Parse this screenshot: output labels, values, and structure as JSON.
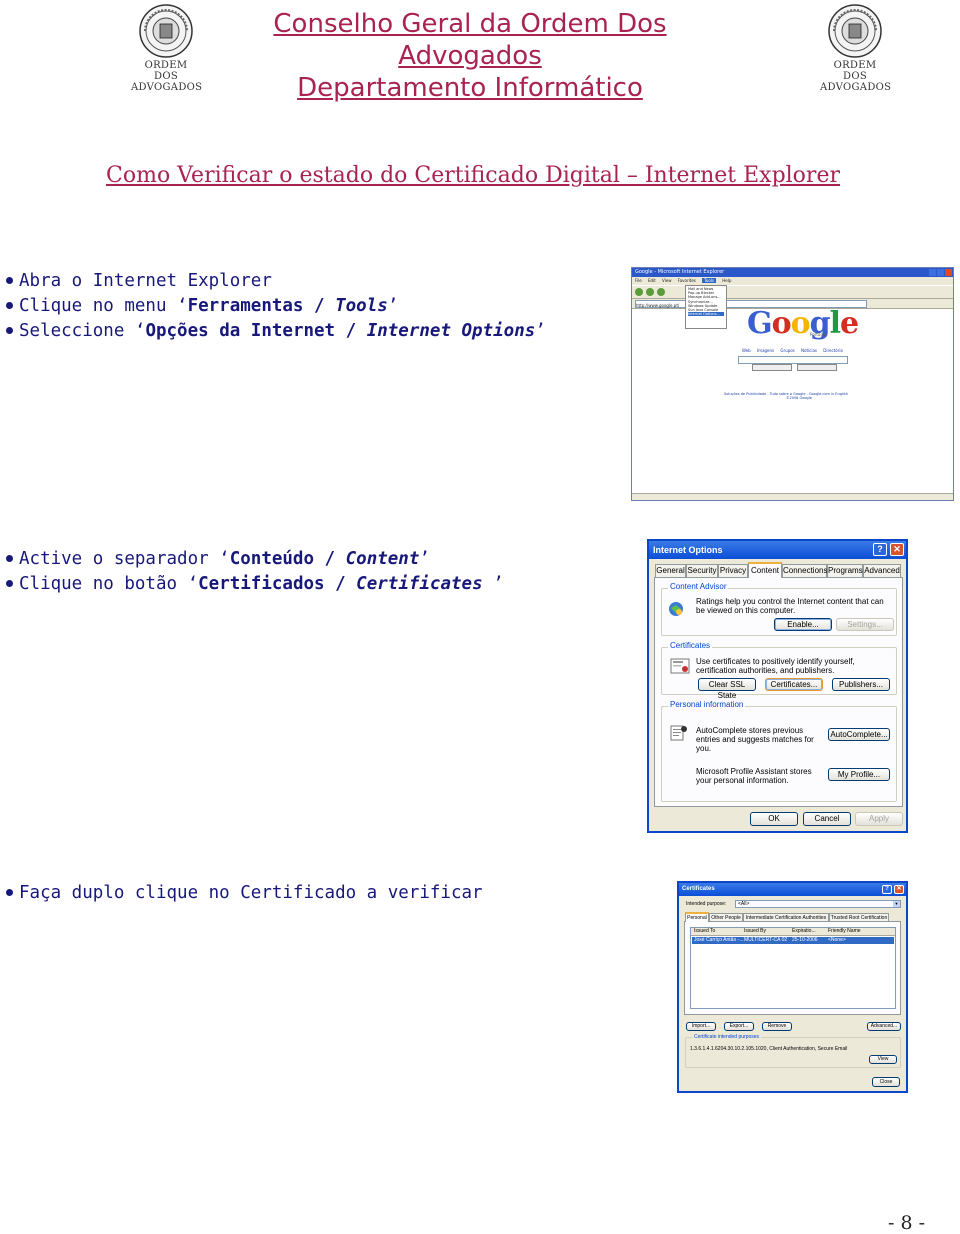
{
  "header": {
    "org_line1": "Conselho Geral da Ordem Dos Advogados",
    "org_line2": "Departamento Informático",
    "seal_line1": "ORDEM DOS",
    "seal_line2": "ADVOGADOS"
  },
  "title": "Como Verificar o estado do Certificado Digital – Internet Explorer",
  "steps1": [
    {
      "plain": "Abra o Internet Explorer"
    },
    {
      "pre": "Clique no menu ‘",
      "bold": "Ferramentas / ",
      "ital": "Tools",
      "post": "’"
    },
    {
      "pre": "Seleccione ‘",
      "bold": "Opções da Internet / ",
      "ital": "Internet Options",
      "post": "’"
    }
  ],
  "steps2": [
    {
      "pre": "Active o separador ‘",
      "bold": "Conteúdo / ",
      "ital": "Content",
      "post": "’"
    },
    {
      "pre": "Clique no botão ‘",
      "bold": "Certificados / ",
      "ital": "Certificates ",
      "post": "’"
    }
  ],
  "steps3": [
    {
      "plain": "Faça duplo clique no Certificado a verificar"
    }
  ],
  "ie_window": {
    "title": "Google - Microsoft Internet Explorer",
    "menu": [
      "File",
      "Edit",
      "View",
      "Favorites",
      "Tools",
      "Help"
    ],
    "tools_menu": [
      "Mail and News",
      "Pop-up Blocker",
      "Manage Add-ons...",
      "Synchronize...",
      "Windows Update",
      "Sun Java Console",
      "Internet Options..."
    ],
    "address": "http://www.google.pt/",
    "logo": [
      "G",
      "o",
      "o",
      "g",
      "l",
      "e"
    ],
    "logo_sub": "Portugal",
    "links": "Web  Imagens  Grupos  Notícias  Directório",
    "buttons": [
      "Pesquisa Google",
      "Sinto-me com sorte"
    ],
    "footer": "Soluções de Publicidade - Tudo sobre o Google - Google.com in English",
    "copyright": "©2006 Google"
  },
  "options_dialog": {
    "title": "Internet Options",
    "tabs": [
      "General",
      "Security",
      "Privacy",
      "Content",
      "Connections",
      "Programs",
      "Advanced"
    ],
    "content_advisor": {
      "label": "Content Advisor",
      "text": "Ratings help you control the Internet content that can be viewed on this computer.",
      "enable": "Enable...",
      "settings": "Settings..."
    },
    "certificates": {
      "label": "Certificates",
      "text": "Use certificates to positively identify yourself, certification authorities, and publishers.",
      "clear_ssl": "Clear SSL State",
      "certificates": "Certificates...",
      "publishers": "Publishers..."
    },
    "personal": {
      "label": "Personal information",
      "autocomplete_text": "AutoComplete stores previous entries and suggests matches for you.",
      "autocomplete": "AutoComplete...",
      "profile_text": "Microsoft Profile Assistant stores your personal information.",
      "my_profile": "My Profile..."
    },
    "ok": "OK",
    "cancel": "Cancel",
    "apply": "Apply"
  },
  "certs_dialog": {
    "title": "Certificates",
    "purpose_label": "Intended purpose:",
    "purpose_value": "<All>",
    "tabs": [
      "Personal",
      "Other People",
      "Intermediate Certification Authorities",
      "Trusted Root Certification"
    ],
    "columns": [
      "Issued To",
      "Issued By",
      "Expiratio...",
      "Friendly Name"
    ],
    "row": [
      "José Carriço Antão -...",
      "MULTICERT-CA 02",
      "25-10-2006",
      "<None>"
    ],
    "import": "Import...",
    "export": "Export...",
    "remove": "Remove",
    "advanced": "Advanced...",
    "purposes_label": "Certificate intended purposes",
    "purposes_value": "1.3.6.1.4.1.6204.30.10.2.105.1020, Client Authentication, Secure Email",
    "view": "View",
    "close": "Close"
  },
  "page_number": "- 8 -"
}
